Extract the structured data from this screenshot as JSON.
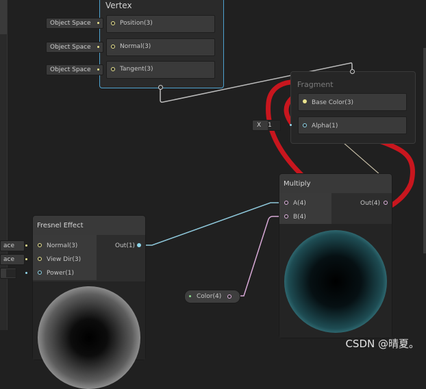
{
  "vertex": {
    "title": "Vertex",
    "ports": [
      {
        "label": "Position(3)",
        "space": "Object Space"
      },
      {
        "label": "Normal(3)",
        "space": "Object Space"
      },
      {
        "label": "Tangent(3)",
        "space": "Object Space"
      }
    ]
  },
  "fragment": {
    "title": "Fragment",
    "ports": [
      {
        "label": "Base Color(3)"
      },
      {
        "label": "Alpha(1)",
        "input_axis": "X",
        "input_value": "1"
      }
    ]
  },
  "multiply": {
    "title": "Multiply",
    "inputs": [
      "A(4)",
      "B(4)"
    ],
    "output": "Out(4)"
  },
  "fresnel": {
    "title": "Fresnel Effect",
    "inputs": [
      {
        "label": "Normal(3)",
        "space": "ace"
      },
      {
        "label": "View Dir(3)",
        "space": "ace"
      },
      {
        "label": "Power(1)",
        "value": ""
      }
    ],
    "output": "Out(1)"
  },
  "color_property": {
    "label": "Color(4)"
  },
  "watermark": "CSDN @晴夏。",
  "colors": {
    "background": "#202020",
    "node": "#2d2d2d",
    "selection": "#4ea3d0",
    "vector3": "#e9e38e",
    "vector1": "#8fd6ea",
    "vector4": "#e1b4e0",
    "annotation_red": "#c8161e"
  }
}
